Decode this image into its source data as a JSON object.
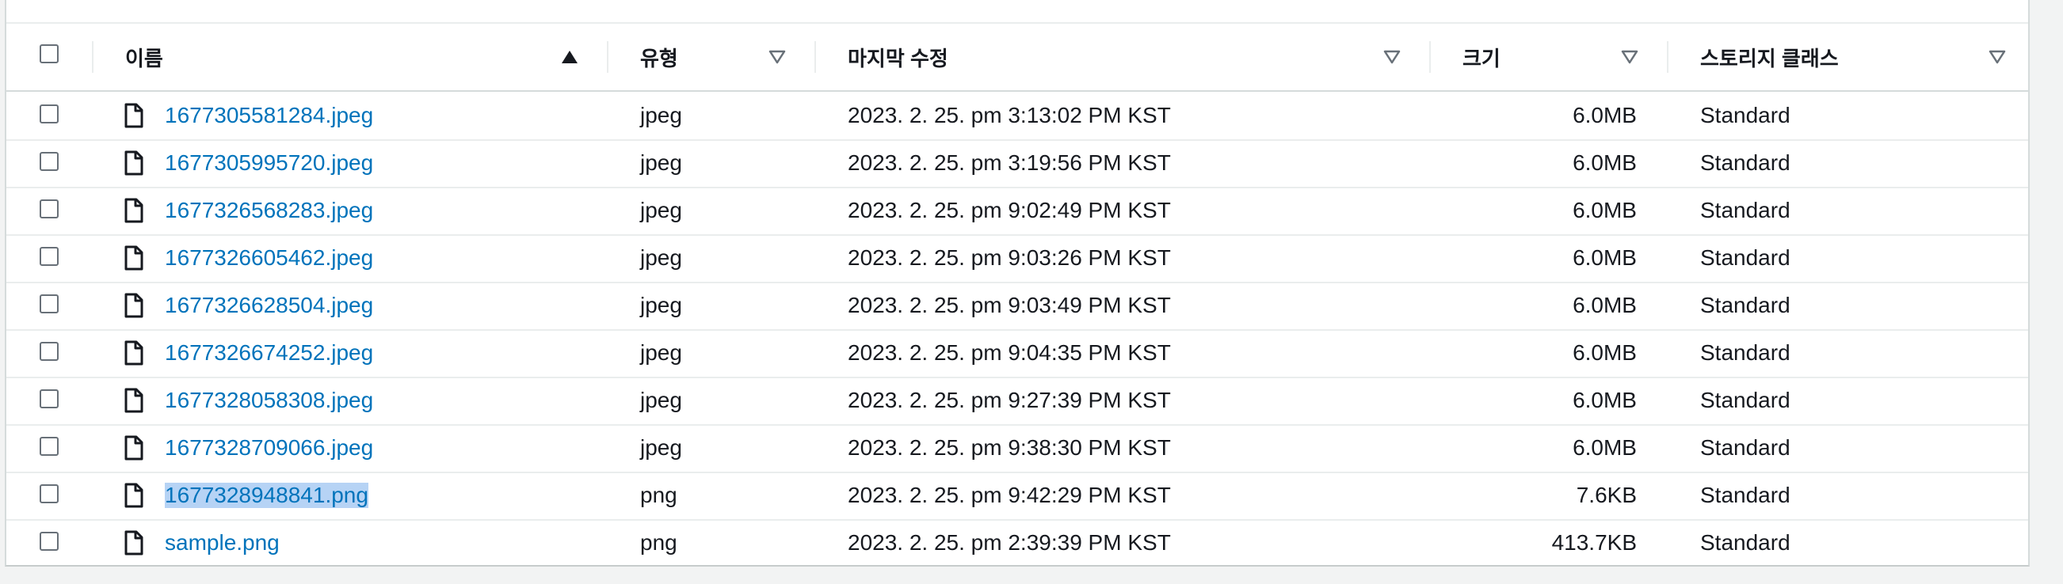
{
  "table": {
    "columns": {
      "name": "이름",
      "type": "유형",
      "modified": "마지막 수정",
      "size": "크기",
      "storage_class": "스토리지 클래스"
    },
    "sort": {
      "column": "name",
      "direction": "ascending"
    },
    "rows": [
      {
        "name": "1677305581284.jpeg",
        "type": "jpeg",
        "modified": "2023. 2. 25. pm 3:13:02 PM KST",
        "size": "6.0MB",
        "storage_class": "Standard"
      },
      {
        "name": "1677305995720.jpeg",
        "type": "jpeg",
        "modified": "2023. 2. 25. pm 3:19:56 PM KST",
        "size": "6.0MB",
        "storage_class": "Standard"
      },
      {
        "name": "1677326568283.jpeg",
        "type": "jpeg",
        "modified": "2023. 2. 25. pm 9:02:49 PM KST",
        "size": "6.0MB",
        "storage_class": "Standard"
      },
      {
        "name": "1677326605462.jpeg",
        "type": "jpeg",
        "modified": "2023. 2. 25. pm 9:03:26 PM KST",
        "size": "6.0MB",
        "storage_class": "Standard"
      },
      {
        "name": "1677326628504.jpeg",
        "type": "jpeg",
        "modified": "2023. 2. 25. pm 9:03:49 PM KST",
        "size": "6.0MB",
        "storage_class": "Standard"
      },
      {
        "name": "1677326674252.jpeg",
        "type": "jpeg",
        "modified": "2023. 2. 25. pm 9:04:35 PM KST",
        "size": "6.0MB",
        "storage_class": "Standard"
      },
      {
        "name": "1677328058308.jpeg",
        "type": "jpeg",
        "modified": "2023. 2. 25. pm 9:27:39 PM KST",
        "size": "6.0MB",
        "storage_class": "Standard"
      },
      {
        "name": "1677328709066.jpeg",
        "type": "jpeg",
        "modified": "2023. 2. 25. pm 9:38:30 PM KST",
        "size": "6.0MB",
        "storage_class": "Standard"
      },
      {
        "name": "1677328948841.png",
        "type": "png",
        "modified": "2023. 2. 25. pm 9:42:29 PM KST",
        "size": "7.6KB",
        "storage_class": "Standard",
        "selected_text": true
      },
      {
        "name": "sample.png",
        "type": "png",
        "modified": "2023. 2. 25. pm 2:39:39 PM KST",
        "size": "413.7KB",
        "storage_class": "Standard"
      }
    ]
  },
  "icons": {
    "row_icon": "file-icon",
    "sort_active": "triangle-up-icon",
    "sort_inactive": "triangle-down-outline-icon"
  },
  "colors": {
    "link": "#0073bb",
    "selection": "#b6d3f5",
    "border": "#eaeded"
  }
}
